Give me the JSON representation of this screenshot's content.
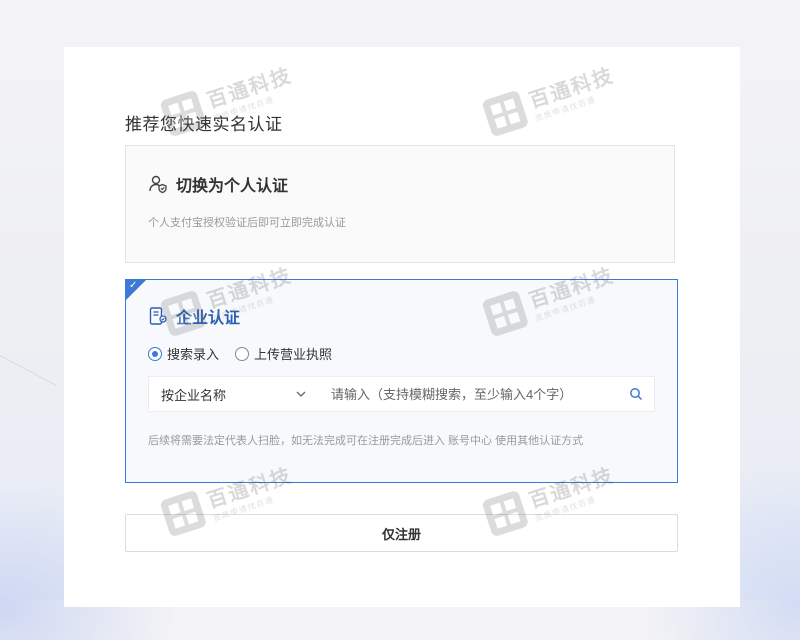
{
  "page": {
    "section_title": "推荐您快速实名认证"
  },
  "personal_option": {
    "icon": "person-shield-icon",
    "title": "切换为个人认证",
    "description": "个人支付宝授权验证后即可立即完成认证"
  },
  "enterprise_option": {
    "icon": "enterprise-id-icon",
    "title": "企业认证",
    "selected": true,
    "radios": [
      {
        "label": "搜索录入",
        "checked": true
      },
      {
        "label": "上传营业执照",
        "checked": false
      }
    ],
    "search": {
      "type_selected": "按企业名称",
      "placeholder": "请输入（支持模糊搜索，至少输入4个字）"
    },
    "note": "后续将需要法定代表人扫脸，如无法完成可在注册完成后进入 账号中心 使用其他认证方式"
  },
  "register_button": {
    "label": "仅注册"
  },
  "watermark": {
    "main": "百通科技",
    "sub": "资质申请找百通"
  },
  "colors": {
    "accent": "#3d7ad6",
    "accent_text": "#2c5fb3",
    "muted_text": "#999999"
  }
}
